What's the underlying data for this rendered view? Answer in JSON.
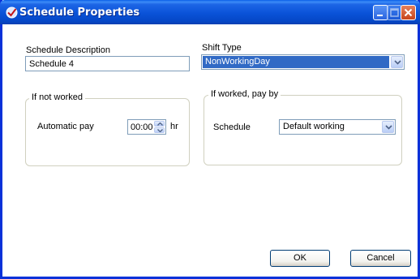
{
  "window": {
    "title": "Schedule Properties",
    "title_icon": "checkmark-app-icon",
    "controls": [
      "minimize-icon",
      "maximize-icon",
      "close-icon"
    ]
  },
  "schedule_description": {
    "label": "Schedule Description",
    "value": "Schedule 4"
  },
  "shift_type": {
    "label": "Shift Type",
    "value": "NonWorkingDay"
  },
  "if_not_worked": {
    "title": "If not worked",
    "automatic_pay_label": "Automatic pay",
    "automatic_pay_value": "00:00",
    "unit": "hr"
  },
  "if_worked": {
    "title": "If worked, pay by",
    "schedule_label": "Schedule",
    "schedule_value": "Default working"
  },
  "buttons": {
    "ok": "OK",
    "cancel": "Cancel"
  },
  "colors": {
    "titlebar": "#0a52d8",
    "selection": "#316ac5",
    "window_border": "#0831d9"
  }
}
